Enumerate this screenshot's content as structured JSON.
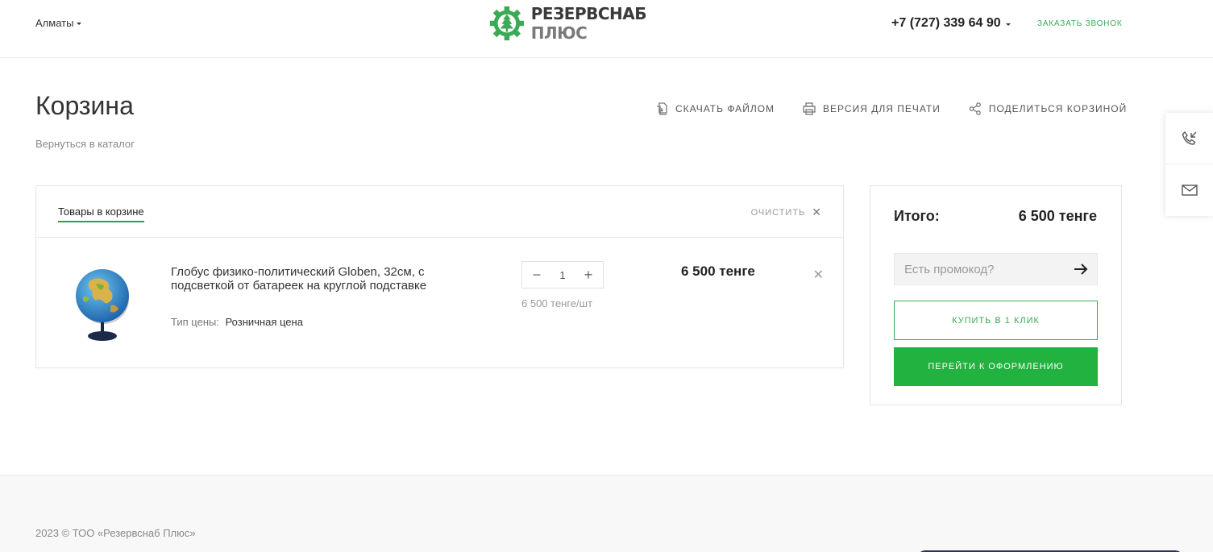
{
  "header": {
    "city": "Алматы",
    "logo": {
      "line1": "РЕЗЕРВСНАБ",
      "line2": "ПЛЮС"
    },
    "phone": "+7 (727) 339 64 90",
    "callback": "ЗАКАЗАТЬ ЗВОНОК"
  },
  "page": {
    "title": "Корзина",
    "back": "Вернуться в каталог",
    "actions": {
      "download": "СКАЧАТЬ ФАЙЛОМ",
      "print": "ВЕРСИЯ ДЛЯ ПЕЧАТИ",
      "share": "ПОДЕЛИТЬСЯ КОРЗИНОЙ"
    }
  },
  "cart": {
    "tab": "Товары в корзине",
    "clear": "ОЧИСТИТЬ",
    "items": [
      {
        "name": "Глобус физико-политический Globen, 32см, с подсветкой от батареек на круглой подставке",
        "price_type_label": "Тип цены:",
        "price_type_value": "Розничная цена",
        "qty": "1",
        "unit_price": "6 500 тенге/шт",
        "total": "6 500 тенге"
      }
    ]
  },
  "summary": {
    "label": "Итого:",
    "value": "6 500 тенге",
    "promo_placeholder": "Есть промокод?",
    "buy_one": "КУПИТЬ В 1 КЛИК",
    "checkout": "ПЕРЕЙТИ К ОФОРМЛЕНИЮ"
  },
  "footer": {
    "copyright": "2023 © ТОО «Резервснаб Плюс»"
  },
  "colors": {
    "accent": "#21b23f",
    "accent_text": "#3aaa54"
  },
  "icons": [
    "chevron-down-icon",
    "gear-tree-logo-icon",
    "file-download-icon",
    "printer-icon",
    "share-icon",
    "close-icon",
    "minus-icon",
    "plus-icon",
    "arrow-right-icon",
    "phone-callback-icon",
    "mail-icon"
  ]
}
